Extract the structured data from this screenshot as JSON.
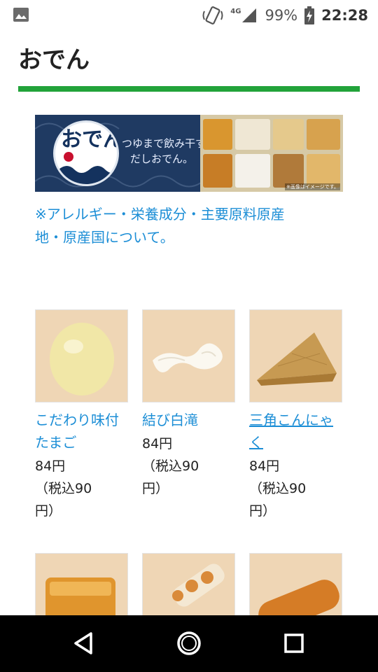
{
  "status_bar": {
    "network": "4G",
    "battery": "99%",
    "time": "22:28"
  },
  "page": {
    "title": "おでん",
    "accent_color": "#22a33a",
    "link_color": "#1c8ed6"
  },
  "banner": {
    "logo_text": "おでん だし",
    "catch_line1": "つゆまで飲み干す",
    "catch_line2": "だしおでん。",
    "note": "※画像はイメージです。"
  },
  "allergy_link": {
    "line1": "※アレルギー・栄養成分・主要原料原産",
    "line2": "地・原産国について。"
  },
  "products": [
    {
      "name_line1": "こだわり味付",
      "name_line2": "たまご",
      "price": "84円",
      "tax_line1": "（税込90",
      "tax_line2": "円）"
    },
    {
      "name_line1": "結び白滝",
      "name_line2": "",
      "price": "84円",
      "tax_line1": "（税込90",
      "tax_line2": "円）"
    },
    {
      "name_line1": "三角こんにゃ",
      "name_line2": "く",
      "price": "84円",
      "tax_line1": "（税込90",
      "tax_line2": "円）"
    }
  ],
  "icons": {
    "status_left": "image-icon",
    "signal": "signal-icon",
    "battery": "battery-charging-icon",
    "nav_back": "back-triangle-icon",
    "nav_home": "home-circle-icon",
    "nav_recents": "recents-square-icon"
  }
}
